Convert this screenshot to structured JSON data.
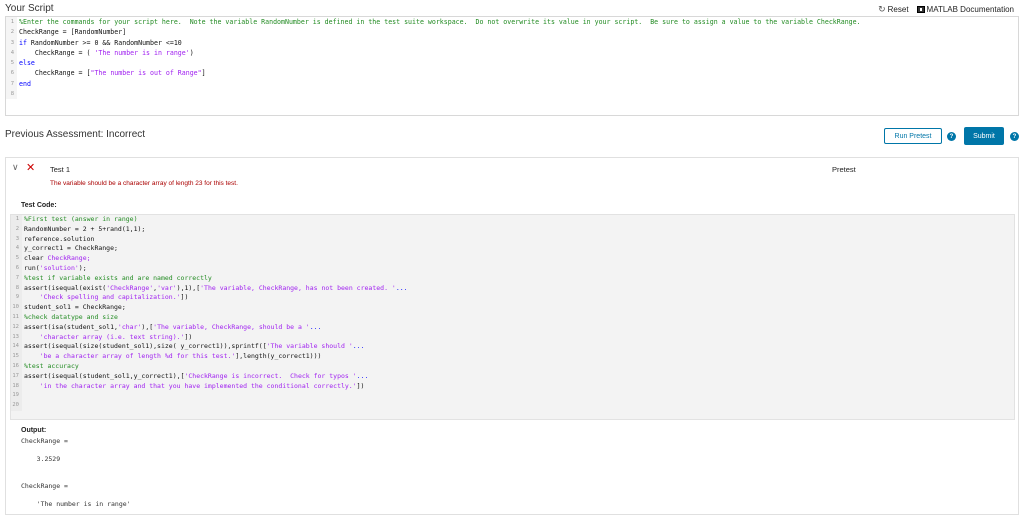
{
  "header": {
    "title": "Your Script",
    "reset_label": "Reset",
    "doc_label": "MATLAB Documentation"
  },
  "script_lines": [
    [
      {
        "t": "%Enter the commands for your script here.  Note the variable RandomNumber is defined in the test suite workspace.  Do not overwrite its value in your script.  Be sure to assign a value to the variable CheckRange.",
        "c": "cm"
      }
    ],
    [
      {
        "t": "CheckRange = [RandomNumber]",
        "c": ""
      }
    ],
    [
      {
        "t": "if",
        "c": "kw"
      },
      {
        "t": " RandomNumber >= 0 && RandomNumber <=10",
        "c": ""
      }
    ],
    [
      {
        "t": "    CheckRange = ( ",
        "c": ""
      },
      {
        "t": "'The number is in range'",
        "c": "str"
      },
      {
        "t": ")",
        "c": ""
      }
    ],
    [
      {
        "t": "else",
        "c": "kw"
      }
    ],
    [
      {
        "t": "    CheckRange = [",
        "c": ""
      },
      {
        "t": "\"The number is out of Range\"",
        "c": "str"
      },
      {
        "t": "]",
        "c": ""
      }
    ],
    [
      {
        "t": "end",
        "c": "kw"
      }
    ],
    [
      {
        "t": "",
        "c": ""
      }
    ]
  ],
  "assessment": {
    "title": "Previous Assessment: Incorrect",
    "run_label": "Run Pretest",
    "submit_label": "Submit",
    "help_glyph": "?"
  },
  "test": {
    "title": "Test 1",
    "type": "Pretest",
    "message": "The variable should be a character array of length 23 for this test.",
    "code_label": "Test Code:",
    "code_lines": [
      [
        {
          "t": "%First test (answer in range)",
          "c": "cm"
        }
      ],
      [
        {
          "t": "RandomNumber = 2 + 5+rand(1,1);",
          "c": ""
        }
      ],
      [
        {
          "t": "reference.solution",
          "c": ""
        }
      ],
      [
        {
          "t": "y_correct1 = CheckRange;",
          "c": ""
        }
      ],
      [
        {
          "t": "clear ",
          "c": ""
        },
        {
          "t": "CheckRange;",
          "c": "str"
        }
      ],
      [
        {
          "t": "run(",
          "c": ""
        },
        {
          "t": "'solution'",
          "c": "str"
        },
        {
          "t": ");",
          "c": ""
        }
      ],
      [
        {
          "t": "%test if variable exists and are named correctly",
          "c": "cm"
        }
      ],
      [
        {
          "t": "assert(isequal(exist(",
          "c": ""
        },
        {
          "t": "'CheckRange'",
          "c": "str"
        },
        {
          "t": ",",
          "c": ""
        },
        {
          "t": "'var'",
          "c": "str"
        },
        {
          "t": "),1),[",
          "c": ""
        },
        {
          "t": "'The variable, CheckRange, has not been created. '",
          "c": "str"
        },
        {
          "t": "...",
          "c": "kw"
        }
      ],
      [
        {
          "t": "    ",
          "c": ""
        },
        {
          "t": "'Check spelling and capitalization.'",
          "c": "str"
        },
        {
          "t": "])",
          "c": ""
        }
      ],
      [
        {
          "t": "student_sol1 = CheckRange;",
          "c": ""
        }
      ],
      [
        {
          "t": "%check datatype and size",
          "c": "cm"
        }
      ],
      [
        {
          "t": "assert(isa(student_sol1,",
          "c": ""
        },
        {
          "t": "'char'",
          "c": "str"
        },
        {
          "t": "),[",
          "c": ""
        },
        {
          "t": "'The variable, CheckRange, should be a '",
          "c": "str"
        },
        {
          "t": "...",
          "c": "kw"
        }
      ],
      [
        {
          "t": "    ",
          "c": ""
        },
        {
          "t": "'character array (i.e. text string).'",
          "c": "str"
        },
        {
          "t": "])",
          "c": ""
        }
      ],
      [
        {
          "t": "assert(isequal(size(student_sol1),size( y_correct1)),sprintf([",
          "c": ""
        },
        {
          "t": "'The variable should '",
          "c": "str"
        },
        {
          "t": "...",
          "c": "kw"
        }
      ],
      [
        {
          "t": "    ",
          "c": ""
        },
        {
          "t": "'be a character array of length %d for this test.'",
          "c": "str"
        },
        {
          "t": "],length(y_correct1)))",
          "c": ""
        }
      ],
      [
        {
          "t": "%test accuracy",
          "c": "cm"
        }
      ],
      [
        {
          "t": "assert(isequal(student_sol1,y_correct1),[",
          "c": ""
        },
        {
          "t": "'CheckRange is incorrect.  Check for typos '",
          "c": "str"
        },
        {
          "t": "...",
          "c": "kw"
        }
      ],
      [
        {
          "t": "    ",
          "c": ""
        },
        {
          "t": "'in the character array and that you have implemented the conditional correctly.'",
          "c": "str"
        },
        {
          "t": "])",
          "c": ""
        }
      ],
      [
        {
          "t": "",
          "c": ""
        }
      ],
      [
        {
          "t": "",
          "c": ""
        }
      ]
    ],
    "output_label": "Output:",
    "output_text": "CheckRange =\n\n    3.2529\n\n\nCheckRange =\n\n    'The number is in range'"
  }
}
